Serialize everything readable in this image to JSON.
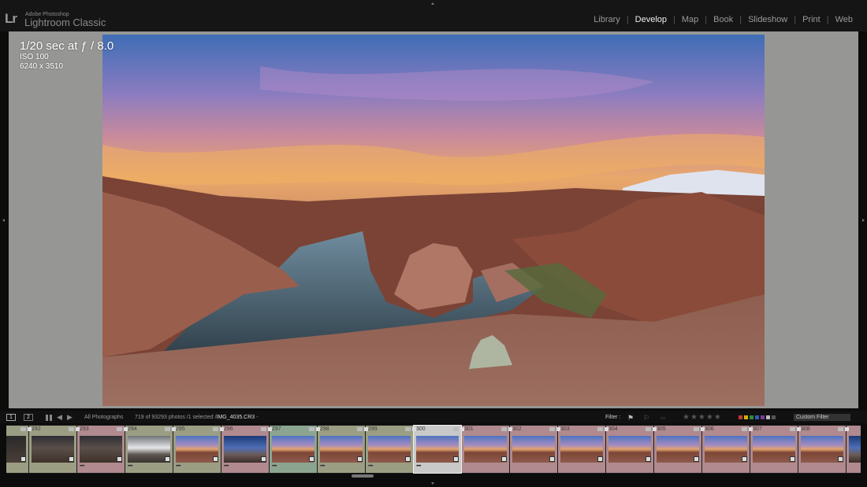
{
  "app": {
    "brand_small": "Adobe Photoshop",
    "brand_name": "Lightroom Classic",
    "logo": "Lr"
  },
  "modules": [
    {
      "label": "Library",
      "active": false
    },
    {
      "label": "Develop",
      "active": true
    },
    {
      "label": "Map",
      "active": false
    },
    {
      "label": "Book",
      "active": false
    },
    {
      "label": "Slideshow",
      "active": false
    },
    {
      "label": "Print",
      "active": false
    },
    {
      "label": "Web",
      "active": false
    }
  ],
  "info_overlay": {
    "exposure": "1/20 sec at ƒ / 8.0",
    "iso": "ISO 100",
    "dimensions": "6240 x 3510"
  },
  "filmstrip_bar": {
    "page_1": "1",
    "page_2": "2",
    "source": "All Photographs",
    "count_prefix": "719 of 93293 photos /1 selected /",
    "filename": "IMG_4035.CR3",
    "filename_suffix": " -",
    "filter_label": "Filter :",
    "stars": "★★★★★",
    "custom_filter": "Custom Filter",
    "color_labels": [
      "#c0392b",
      "#d4b106",
      "#2e8b3a",
      "#2b5fb3",
      "#7d3c98",
      "#bbbbbb",
      "#555555"
    ]
  },
  "filmstrip": [
    {
      "num": "",
      "bg": "#9c9e84",
      "thumb": "dark",
      "dots": ""
    },
    {
      "num": "292",
      "bg": "#9c9e84",
      "thumb": "dusk",
      "dots": ""
    },
    {
      "num": "293",
      "bg": "#b08a8f",
      "thumb": "dusk",
      "dots": "•••••"
    },
    {
      "num": "294",
      "bg": "#9c9e84",
      "thumb": "grey",
      "dots": "•••••"
    },
    {
      "num": "295",
      "bg": "#9c9e84",
      "thumb": "sunset",
      "dots": "•••••"
    },
    {
      "num": "296",
      "bg": "#b08a8f",
      "thumb": "blue",
      "dots": "•••••"
    },
    {
      "num": "297",
      "bg": "#8ca591",
      "thumb": "sunset",
      "dots": "•••••"
    },
    {
      "num": "298",
      "bg": "#9c9e84",
      "thumb": "sunset",
      "dots": "•••••"
    },
    {
      "num": "299",
      "bg": "#9c9e84",
      "thumb": "sunset",
      "dots": "•••••"
    },
    {
      "num": "300",
      "bg": "#c9c9c9",
      "thumb": "sunset",
      "dots": "•••••",
      "selected": true
    },
    {
      "num": "301",
      "bg": "#b08a8f",
      "thumb": "sunset",
      "dots": ""
    },
    {
      "num": "302",
      "bg": "#b08a8f",
      "thumb": "sunset",
      "dots": ""
    },
    {
      "num": "303",
      "bg": "#b08a8f",
      "thumb": "sunset",
      "dots": ""
    },
    {
      "num": "304",
      "bg": "#b08a8f",
      "thumb": "sunset",
      "dots": ""
    },
    {
      "num": "305",
      "bg": "#b08a8f",
      "thumb": "sunset",
      "dots": ""
    },
    {
      "num": "306",
      "bg": "#b08a8f",
      "thumb": "sunset",
      "dots": ""
    },
    {
      "num": "307",
      "bg": "#b08a8f",
      "thumb": "sunset",
      "dots": ""
    },
    {
      "num": "308",
      "bg": "#b08a8f",
      "thumb": "sunset",
      "dots": ""
    },
    {
      "num": "",
      "bg": "#b08a8f",
      "thumb": "blue",
      "dots": ""
    }
  ],
  "icons": {
    "filter_flag": "pick-flag-icon",
    "filter_reject": "reject-flag-icon",
    "grid": "grid-view-icon",
    "back": "arrow-left-icon",
    "forward": "arrow-right-icon"
  }
}
